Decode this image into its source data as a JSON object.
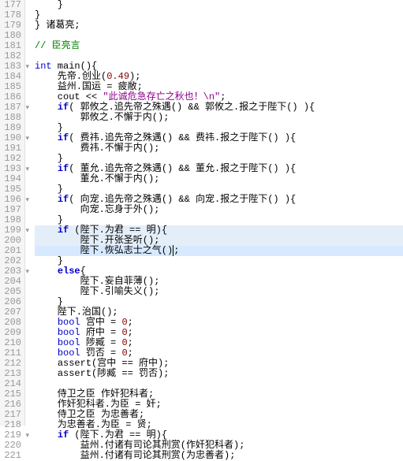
{
  "lines": [
    {
      "num": "177",
      "fold": "",
      "code": [
        {
          "t": "    }",
          "c": "pn"
        }
      ]
    },
    {
      "num": "178",
      "fold": "",
      "code": [
        {
          "t": "}",
          "c": "pn"
        }
      ]
    },
    {
      "num": "179",
      "fold": "",
      "code": [
        {
          "t": "} 诸葛亮;",
          "c": "pn"
        }
      ]
    },
    {
      "num": "180",
      "fold": "",
      "code": []
    },
    {
      "num": "181",
      "fold": "",
      "code": [
        {
          "t": "// 臣亮言",
          "c": "cm"
        }
      ]
    },
    {
      "num": "182",
      "fold": "",
      "code": []
    },
    {
      "num": "183",
      "fold": "▾",
      "code": [
        {
          "t": "int",
          "c": "ty"
        },
        {
          "t": " main(){",
          "c": "pn"
        }
      ]
    },
    {
      "num": "184",
      "fold": "",
      "code": [
        {
          "t": "    先帝.创业(",
          "c": "pn"
        },
        {
          "t": "0.49",
          "c": "nm"
        },
        {
          "t": ");",
          "c": "pn"
        }
      ]
    },
    {
      "num": "185",
      "fold": "",
      "code": [
        {
          "t": "    益州.国运 = 疲敝;",
          "c": "pn"
        }
      ]
    },
    {
      "num": "186",
      "fold": "",
      "code": [
        {
          "t": "    cout << ",
          "c": "pn"
        },
        {
          "t": "\"此诚危急存亡之秋也！\\n\"",
          "c": "st"
        },
        {
          "t": ";",
          "c": "pn"
        }
      ]
    },
    {
      "num": "187",
      "fold": "▾",
      "code": [
        {
          "t": "    ",
          "c": "pn"
        },
        {
          "t": "if",
          "c": "kw"
        },
        {
          "t": "( 郭攸之.追先帝之殊遇() && 郭攸之.报之于陛下() ){",
          "c": "pn"
        }
      ]
    },
    {
      "num": "188",
      "fold": "",
      "code": [
        {
          "t": "        郭攸之.不懈于内();",
          "c": "pn"
        }
      ]
    },
    {
      "num": "189",
      "fold": "",
      "code": [
        {
          "t": "    }",
          "c": "pn"
        }
      ]
    },
    {
      "num": "190",
      "fold": "▾",
      "code": [
        {
          "t": "    ",
          "c": "pn"
        },
        {
          "t": "if",
          "c": "kw"
        },
        {
          "t": "( 费祎.追先帝之殊遇() && 费祎.报之于陛下() ){",
          "c": "pn"
        }
      ]
    },
    {
      "num": "191",
      "fold": "",
      "code": [
        {
          "t": "        费祎.不懈于内();",
          "c": "pn"
        }
      ]
    },
    {
      "num": "192",
      "fold": "",
      "code": [
        {
          "t": "    }",
          "c": "pn"
        }
      ]
    },
    {
      "num": "193",
      "fold": "▾",
      "code": [
        {
          "t": "    ",
          "c": "pn"
        },
        {
          "t": "if",
          "c": "kw"
        },
        {
          "t": "( 董允.追先帝之殊遇() && 董允.报之于陛下() ){",
          "c": "pn"
        }
      ]
    },
    {
      "num": "194",
      "fold": "",
      "code": [
        {
          "t": "        董允.不懈于内();",
          "c": "pn"
        }
      ]
    },
    {
      "num": "195",
      "fold": "",
      "code": [
        {
          "t": "    }",
          "c": "pn"
        }
      ]
    },
    {
      "num": "196",
      "fold": "▾",
      "code": [
        {
          "t": "    ",
          "c": "pn"
        },
        {
          "t": "if",
          "c": "kw"
        },
        {
          "t": "( 向宠.追先帝之殊遇() && 向宠.报之于陛下() ){",
          "c": "pn"
        }
      ]
    },
    {
      "num": "197",
      "fold": "",
      "code": [
        {
          "t": "        向宠.忘身于外();",
          "c": "pn"
        }
      ]
    },
    {
      "num": "198",
      "fold": "",
      "code": [
        {
          "t": "    }",
          "c": "pn"
        }
      ]
    },
    {
      "num": "199",
      "fold": "▾",
      "hl": "hl2",
      "code": [
        {
          "t": "    ",
          "c": "pn"
        },
        {
          "t": "if",
          "c": "kw"
        },
        {
          "t": " (陛下.为君 == 明){",
          "c": "pn"
        }
      ]
    },
    {
      "num": "200",
      "fold": "",
      "hl": "hl2",
      "code": [
        {
          "t": "        陛下.开张圣听();",
          "c": "pn"
        }
      ]
    },
    {
      "num": "201",
      "fold": "",
      "hl": "hl",
      "code": [
        {
          "t": "        陛下.恢弘志士之气()",
          "c": "pn"
        },
        {
          "t": ";",
          "c": "pn cursor"
        }
      ]
    },
    {
      "num": "202",
      "fold": "",
      "code": [
        {
          "t": "    }",
          "c": "pn"
        }
      ]
    },
    {
      "num": "203",
      "fold": "▾",
      "code": [
        {
          "t": "    ",
          "c": "pn"
        },
        {
          "t": "else",
          "c": "kw"
        },
        {
          "t": "{",
          "c": "pn"
        }
      ]
    },
    {
      "num": "204",
      "fold": "",
      "code": [
        {
          "t": "        陛下.妄自菲薄();",
          "c": "pn"
        }
      ]
    },
    {
      "num": "205",
      "fold": "",
      "code": [
        {
          "t": "        陛下.引喻失义();",
          "c": "pn"
        }
      ]
    },
    {
      "num": "206",
      "fold": "",
      "code": [
        {
          "t": "    }",
          "c": "pn"
        }
      ]
    },
    {
      "num": "207",
      "fold": "",
      "code": [
        {
          "t": "    陛下.治国();",
          "c": "pn"
        }
      ]
    },
    {
      "num": "208",
      "fold": "",
      "code": [
        {
          "t": "    ",
          "c": "pn"
        },
        {
          "t": "bool",
          "c": "ty"
        },
        {
          "t": " 宫中 = ",
          "c": "pn"
        },
        {
          "t": "0",
          "c": "nm"
        },
        {
          "t": ";",
          "c": "pn"
        }
      ]
    },
    {
      "num": "209",
      "fold": "",
      "code": [
        {
          "t": "    ",
          "c": "pn"
        },
        {
          "t": "bool",
          "c": "ty"
        },
        {
          "t": " 府中 = ",
          "c": "pn"
        },
        {
          "t": "0",
          "c": "nm"
        },
        {
          "t": ";",
          "c": "pn"
        }
      ]
    },
    {
      "num": "210",
      "fold": "",
      "code": [
        {
          "t": "    ",
          "c": "pn"
        },
        {
          "t": "bool",
          "c": "ty"
        },
        {
          "t": " 陟臧 = ",
          "c": "pn"
        },
        {
          "t": "0",
          "c": "nm"
        },
        {
          "t": ";",
          "c": "pn"
        }
      ]
    },
    {
      "num": "211",
      "fold": "",
      "code": [
        {
          "t": "    ",
          "c": "pn"
        },
        {
          "t": "bool",
          "c": "ty"
        },
        {
          "t": " 罚否 = ",
          "c": "pn"
        },
        {
          "t": "0",
          "c": "nm"
        },
        {
          "t": ";",
          "c": "pn"
        }
      ]
    },
    {
      "num": "212",
      "fold": "",
      "code": [
        {
          "t": "    ",
          "c": "pn"
        },
        {
          "t": "assert",
          "c": "fn"
        },
        {
          "t": "(宫中 == 府中);",
          "c": "pn"
        }
      ]
    },
    {
      "num": "213",
      "fold": "",
      "code": [
        {
          "t": "    ",
          "c": "pn"
        },
        {
          "t": "assert",
          "c": "fn"
        },
        {
          "t": "(陟臧 == 罚否);",
          "c": "pn"
        }
      ]
    },
    {
      "num": "214",
      "fold": "",
      "code": []
    },
    {
      "num": "215",
      "fold": "",
      "code": [
        {
          "t": "    侍卫之臣 作奸犯科者;",
          "c": "pn"
        }
      ]
    },
    {
      "num": "216",
      "fold": "",
      "code": [
        {
          "t": "    作奸犯科者.为臣 = 奸;",
          "c": "pn"
        }
      ]
    },
    {
      "num": "217",
      "fold": "",
      "code": [
        {
          "t": "    侍卫之臣 为忠善者;",
          "c": "pn"
        }
      ]
    },
    {
      "num": "218",
      "fold": "",
      "code": [
        {
          "t": "    为忠善者.为臣 = 贤;",
          "c": "pn"
        }
      ]
    },
    {
      "num": "219",
      "fold": "▾",
      "code": [
        {
          "t": "    ",
          "c": "pn"
        },
        {
          "t": "if",
          "c": "kw"
        },
        {
          "t": " (陛下.为君 == 明){",
          "c": "pn"
        }
      ]
    },
    {
      "num": "220",
      "fold": "",
      "code": [
        {
          "t": "        益州.付诸有司论其刑赏(作奸犯科者);",
          "c": "pn"
        }
      ]
    },
    {
      "num": "221",
      "fold": "",
      "code": [
        {
          "t": "        益州.付诸有司论其刑赏(为忠善者);",
          "c": "pn"
        }
      ]
    }
  ]
}
